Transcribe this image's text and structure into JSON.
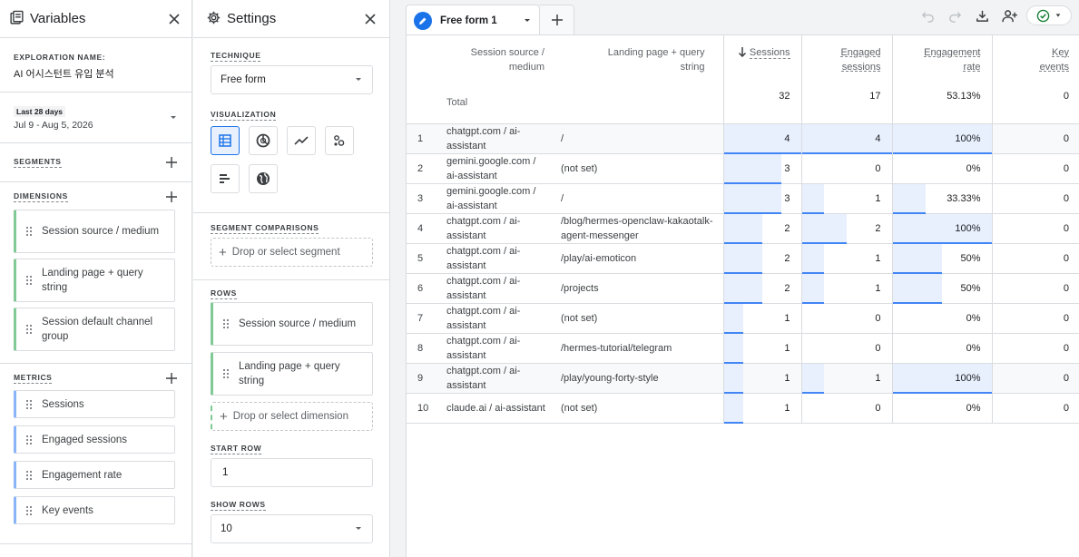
{
  "variables": {
    "title": "Variables",
    "exploration_name_label": "EXPLORATION NAME:",
    "exploration_name": "AI 어시스턴트 유입 분석",
    "date_chip": "Last 28 days",
    "date_range": "Jul 9 - Aug 5, 2026",
    "segments_label": "SEGMENTS",
    "dimensions_label": "DIMENSIONS",
    "dimensions": [
      "Session source / medium",
      "Landing page + query string",
      "Session default channel group"
    ],
    "metrics_label": "METRICS",
    "metrics": [
      "Sessions",
      "Engaged sessions",
      "Engagement rate",
      "Key events"
    ]
  },
  "settings": {
    "title": "Settings",
    "technique_label": "TECHNIQUE",
    "technique": "Free form",
    "visualization_label": "VISUALIZATION",
    "visualization_icons": [
      "table-icon",
      "donut-chart-icon",
      "line-chart-icon",
      "scatter-plot-icon",
      "bar-chart-icon",
      "globe-icon"
    ],
    "segment_comparisons_label": "SEGMENT COMPARISONS",
    "segment_drop": "Drop or select segment",
    "rows_label": "ROWS",
    "rows": [
      "Session source / medium",
      "Landing page + query string"
    ],
    "dimension_drop": "Drop or select dimension",
    "start_row_label": "START ROW",
    "start_row": "1",
    "show_rows_label": "SHOW ROWS",
    "show_rows": "10"
  },
  "canvas": {
    "tab_name": "Free form 1",
    "accent": "#1a73e8",
    "headers": {
      "dim1": "Session source / medium",
      "dim2": "Landing page + query string",
      "sessions": "Sessions",
      "engaged": "Engaged sessions",
      "rate": "Engagement rate",
      "key": "Key events"
    },
    "totals": {
      "label": "Total",
      "sessions": "32",
      "engaged": "17",
      "rate": "53.13%",
      "key": "0"
    },
    "rows": [
      {
        "i": "1",
        "src": "chatgpt.com / ai-assistant",
        "page": "/",
        "s": "4",
        "e": "4",
        "r": "100%",
        "k": "0",
        "sf": 1.0,
        "ef": 1.0,
        "rf": 1.0
      },
      {
        "i": "2",
        "src": "gemini.google.com / ai-assistant",
        "page": "(not set)",
        "s": "3",
        "e": "0",
        "r": "0%",
        "k": "0",
        "sf": 0.75,
        "ef": 0,
        "rf": 0
      },
      {
        "i": "3",
        "src": "gemini.google.com / ai-assistant",
        "page": "/",
        "s": "3",
        "e": "1",
        "r": "33.33%",
        "k": "0",
        "sf": 0.75,
        "ef": 0.25,
        "rf": 0.3333
      },
      {
        "i": "4",
        "src": "chatgpt.com / ai-assistant",
        "page": "/blog/hermes-openclaw-kakaotalk-agent-messenger",
        "s": "2",
        "e": "2",
        "r": "100%",
        "k": "0",
        "sf": 0.5,
        "ef": 0.5,
        "rf": 1.0
      },
      {
        "i": "5",
        "src": "chatgpt.com / ai-assistant",
        "page": "/play/ai-emoticon",
        "s": "2",
        "e": "1",
        "r": "50%",
        "k": "0",
        "sf": 0.5,
        "ef": 0.25,
        "rf": 0.5
      },
      {
        "i": "6",
        "src": "chatgpt.com / ai-assistant",
        "page": "/projects",
        "s": "2",
        "e": "1",
        "r": "50%",
        "k": "0",
        "sf": 0.5,
        "ef": 0.25,
        "rf": 0.5
      },
      {
        "i": "7",
        "src": "chatgpt.com / ai-assistant",
        "page": "(not set)",
        "s": "1",
        "e": "0",
        "r": "0%",
        "k": "0",
        "sf": 0.25,
        "ef": 0,
        "rf": 0
      },
      {
        "i": "8",
        "src": "chatgpt.com / ai-assistant",
        "page": "/hermes-tutorial/telegram",
        "s": "1",
        "e": "0",
        "r": "0%",
        "k": "0",
        "sf": 0.25,
        "ef": 0,
        "rf": 0
      },
      {
        "i": "9",
        "src": "chatgpt.com / ai-assistant",
        "page": "/play/young-forty-style",
        "s": "1",
        "e": "1",
        "r": "100%",
        "k": "0",
        "sf": 0.25,
        "ef": 0.25,
        "rf": 1.0
      },
      {
        "i": "10",
        "src": "claude.ai / ai-assistant",
        "page": "(not set)",
        "s": "1",
        "e": "0",
        "r": "0%",
        "k": "0",
        "sf": 0.25,
        "ef": 0,
        "rf": 0
      }
    ]
  }
}
